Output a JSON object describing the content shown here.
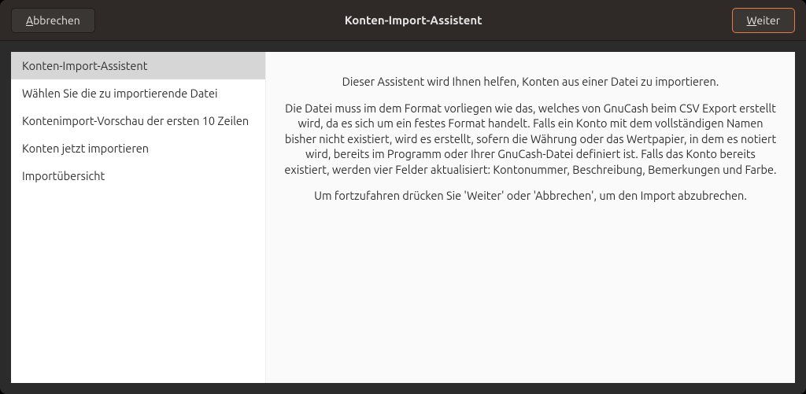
{
  "titlebar": {
    "cancel_prefix": "A",
    "cancel_rest": "bbrechen",
    "title": "Konten-Import-Assistent",
    "next_prefix": "W",
    "next_rest": "eiter"
  },
  "sidebar": {
    "items": [
      {
        "label": "Konten-Import-Assistent",
        "active": true
      },
      {
        "label": "Wählen Sie die zu importierende Datei",
        "active": false
      },
      {
        "label": "Kontenimport-Vorschau der ersten 10 Zeilen",
        "active": false
      },
      {
        "label": "Konten jetzt importieren",
        "active": false
      },
      {
        "label": "Importübersicht",
        "active": false
      }
    ]
  },
  "main": {
    "p1": "Dieser Assistent wird Ihnen helfen, Konten aus einer Datei zu importieren.",
    "p2": "Die Datei muss im dem Format vorliegen wie das, welches von GnuCash beim CSV Export erstellt wird, da es sich um ein festes Format handelt. Falls ein Konto mit dem vollständigen Namen bisher nicht existiert, wird es erstellt, sofern die Währung oder das Wertpapier, in dem es notiert wird, bereits im Programm oder Ihrer GnuCash-Datei definiert ist. Falls das Konto bereits existiert, werden vier Felder aktualisiert: Kontonummer, Beschreibung, Bemerkungen und Farbe.",
    "p3": "Um fortzufahren drücken Sie 'Weiter' oder 'Abbrechen', um den Import abzubrechen."
  }
}
